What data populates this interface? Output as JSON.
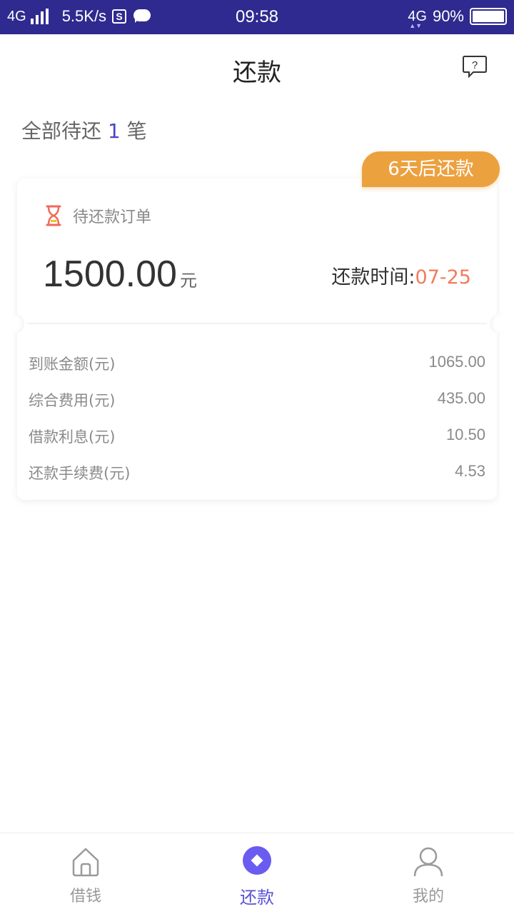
{
  "status_bar": {
    "network_left": "4G",
    "speed": "5.5K/s",
    "s_icon_text": "S",
    "time": "09:58",
    "network_right": "4G",
    "battery": "90%"
  },
  "header": {
    "title": "还款"
  },
  "summary": {
    "prefix": "全部待还",
    "count": "1",
    "suffix": "笔"
  },
  "card": {
    "tag": "6天后还款",
    "status_label": "待还款订单",
    "amount": "1500.00",
    "amount_unit": "元",
    "due_label": "还款时间:",
    "due_date": "07-25",
    "details": [
      {
        "label": "到账金额(元)",
        "value": "1065.00"
      },
      {
        "label": "综合费用(元)",
        "value": "435.00"
      },
      {
        "label": "借款利息(元)",
        "value": "10.50"
      },
      {
        "label": "还款手续费(元)",
        "value": "4.53"
      }
    ]
  },
  "bottom_nav": {
    "items": [
      {
        "label": "借钱",
        "icon": "home-icon"
      },
      {
        "label": "还款",
        "icon": "diamond-icon"
      },
      {
        "label": "我的",
        "icon": "user-icon"
      }
    ],
    "active_color": "#5a52d6"
  },
  "colors": {
    "status_bar": "#2f2a8f",
    "accent": "#4a45c8",
    "tag": "#eca13f",
    "due_date": "#f07c5c"
  }
}
